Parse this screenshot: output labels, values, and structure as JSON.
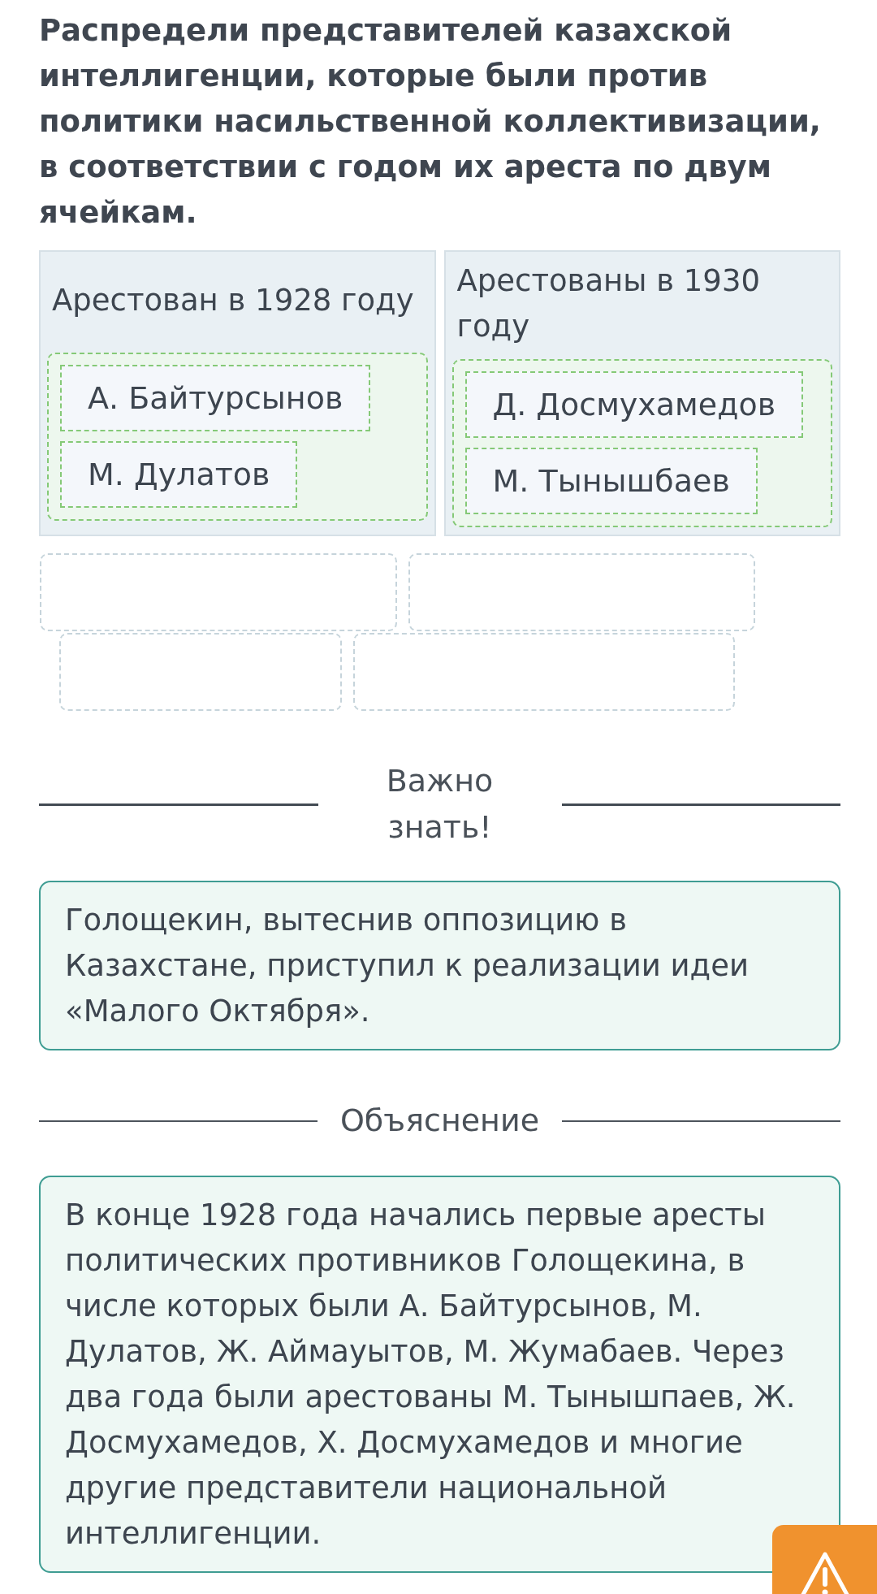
{
  "task": {
    "prompt": "Распредели представителей казахской интеллигенции, которые были против политики насильственной коллективизации, в соответствии с годом их ареста по двум ячейкам."
  },
  "categories": [
    {
      "heading": "Арестован в 1928 году",
      "cards": [
        {
          "label": "А. Байтурсынов"
        },
        {
          "label": "М. Дулатов"
        }
      ]
    },
    {
      "heading": "Арестованы в 1930 году",
      "cards": [
        {
          "label": "Д. Досмухамедов"
        },
        {
          "label": "М. Тынышбаев"
        }
      ]
    }
  ],
  "card_bank": [
    {
      "empty": true
    },
    {
      "empty": true
    },
    {
      "empty": true
    },
    {
      "empty": true
    }
  ],
  "important": {
    "heading": "Важно знать!",
    "text": "Голощекин, вытеснив оппозицию в Казахстане, приступил к реализации идеи «Малого Октября»."
  },
  "explanation": {
    "heading": "Объяснение",
    "text": "В конце 1928 года начались первые аресты политических противников Голощекина, в числе которых были А. Байтурсынов, М. Дулатов, Ж. Аймауытов, М. Жумабаев. Через два года были арестованы М. Тынышпаев, Ж. Досмухамедов, Х. Досмухамедов и многие другие представители национальной интеллигенции."
  }
}
